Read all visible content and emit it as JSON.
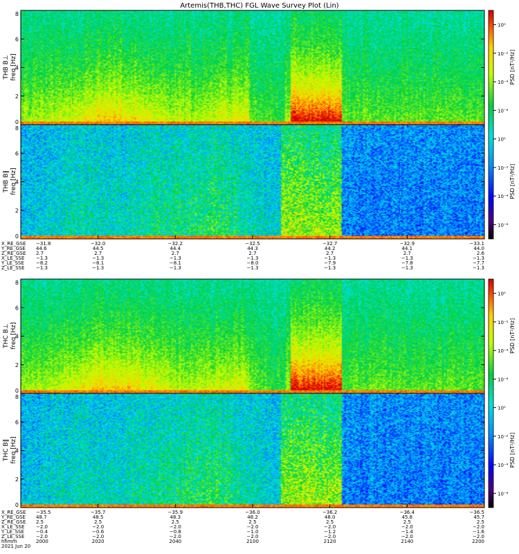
{
  "title": "Artemis(THB,THC) FGL Wave Survey Plot (Lin)",
  "chart_data": {
    "type": "heatmap",
    "title": "Artemis(THB,THC) FGL Wave Survey Plot (Lin)",
    "panels": [
      {
        "id": "thb-bl",
        "label": "THB B⊥",
        "ylabel": "freq [Hz]",
        "ylim": [
          0,
          8
        ],
        "yticks": [
          "0",
          "2",
          "4",
          "6",
          "8"
        ],
        "profile": "perp"
      },
      {
        "id": "thb-bpar",
        "label": "THB B∥",
        "ylabel": "freq [Hz]",
        "ylim": [
          0,
          8
        ],
        "yticks": [
          "0",
          "2",
          "4",
          "6",
          "8"
        ],
        "profile": "par"
      },
      {
        "id": "thc-bl",
        "label": "THC B⊥",
        "ylabel": "freq [Hz]",
        "ylim": [
          0,
          8
        ],
        "yticks": [
          "0",
          "2",
          "4",
          "6",
          "8"
        ],
        "profile": "perp"
      },
      {
        "id": "thc-bpar",
        "label": "THC B∥",
        "ylabel": "freq [Hz]",
        "ylim": [
          0,
          8
        ],
        "yticks": [
          "0",
          "2",
          "4",
          "6",
          "8"
        ],
        "profile": "par"
      }
    ],
    "colorbars": [
      {
        "label": "PSD [nT²/Hz]",
        "ticks": [
          "10⁰",
          "10⁻²",
          "10⁻⁴",
          "10⁻⁶"
        ],
        "range": [
          -7,
          1
        ]
      },
      {
        "label": "PSD [nT²/Hz]",
        "ticks": [
          "10⁰",
          "10⁻²",
          "10⁻⁴",
          "10⁻⁶"
        ],
        "range": [
          -7,
          1
        ]
      }
    ],
    "xaxis": {
      "time_ticks": [
        "2000",
        "2020",
        "2040",
        "2100",
        "2120",
        "2140",
        "2200"
      ],
      "xlim_hhmm": [
        "2000",
        "2200"
      ],
      "date": "2021 Jun 20"
    },
    "ephemeris_top": {
      "rows": [
        {
          "label": "X_RE_GSE",
          "values": [
            "−31.8",
            "−32.0",
            "−32.2",
            "−32.5",
            "−32.7",
            "−32.9",
            "−33.1"
          ]
        },
        {
          "label": "Y_RE_GSE",
          "values": [
            "44.6",
            "44.5",
            "44.4",
            "44.3",
            "44.2",
            "44.1",
            "44.0"
          ]
        },
        {
          "label": "Z_RE_GSE",
          "values": [
            "2.7",
            "2.7",
            "2.7",
            "2.7",
            "2.7",
            "2.7",
            "2.6"
          ]
        },
        {
          "label": "X_LE_SSE",
          "values": [
            "−1.3",
            "−1.3",
            "−1.3",
            "−1.3",
            "−1.3",
            "−1.3",
            "−1.3"
          ]
        },
        {
          "label": "Y_LE_SSE",
          "values": [
            "−8.2",
            "−8.1",
            "−8.1",
            "−8.0",
            "−7.9",
            "−7.8",
            "−7.7"
          ]
        },
        {
          "label": "Z_LE_SSE",
          "values": [
            "−1.3",
            "−1.3",
            "−1.3",
            "−1.3",
            "−1.3",
            "−1.3",
            "−1.3"
          ]
        }
      ]
    },
    "ephemeris_bottom": {
      "rows": [
        {
          "label": "X_RE_GSE",
          "values": [
            "−35.5",
            "−35.7",
            "−35.9",
            "−36.0",
            "−36.2",
            "−36.4",
            "−36.5"
          ]
        },
        {
          "label": "Y_RE_GSE",
          "values": [
            "48.7",
            "48.5",
            "48.3",
            "48.2",
            "48.0",
            "45.8",
            "45.7"
          ]
        },
        {
          "label": "Z_RE_GSE",
          "values": [
            "2.5",
            "2.5",
            "2.5",
            "2.5",
            "2.5",
            "2.5",
            "2.5"
          ]
        },
        {
          "label": "X_LE_SSE",
          "values": [
            "−2.0",
            "−2.0",
            "−2.0",
            "−2.0",
            "−2.0",
            "−2.0",
            "−2.0"
          ]
        },
        {
          "label": "Y_LE_SSE",
          "values": [
            "−0.4",
            "−0.6",
            "−0.8",
            "−1.0",
            "−1.2",
            "−1.4",
            "−1.6"
          ]
        },
        {
          "label": "Z_LE_SSE",
          "values": [
            "−2.0",
            "−2.0",
            "−2.0",
            "−2.0",
            "−2.0",
            "−2.0",
            "−2.0"
          ]
        }
      ],
      "time_label": "hhmm",
      "date_label": "2021 Jun 20"
    }
  }
}
